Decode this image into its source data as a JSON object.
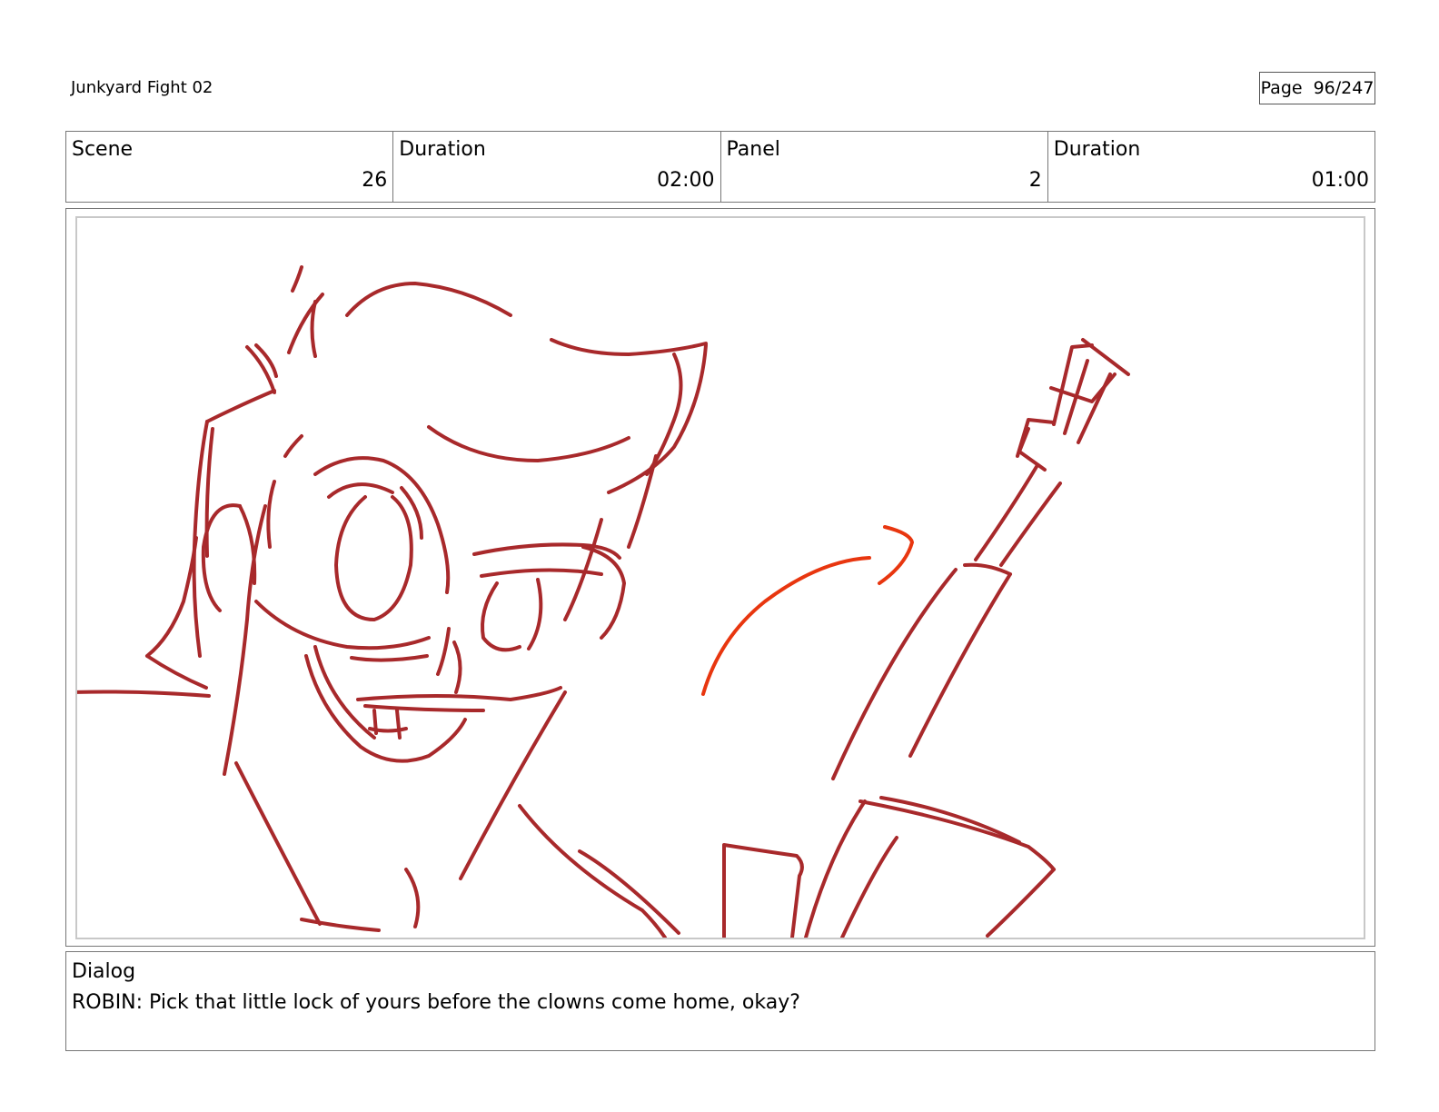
{
  "header": {
    "doc_title": "Junkyard Fight 02",
    "page_label": "Page",
    "page_number": "96/247"
  },
  "info": {
    "scene_label": "Scene",
    "scene_value": "26",
    "scene_duration_label": "Duration",
    "scene_duration_value": "02:00",
    "panel_label": "Panel",
    "panel_value": "2",
    "panel_duration_label": "Duration",
    "panel_duration_value": "01:00"
  },
  "sketch": {
    "stroke_color": "#a8292b",
    "motion_arrow_color": "#e8360f"
  },
  "dialog": {
    "label": "Dialog",
    "text": "ROBIN: Pick that little lock of yours before the clowns come home, okay?"
  }
}
